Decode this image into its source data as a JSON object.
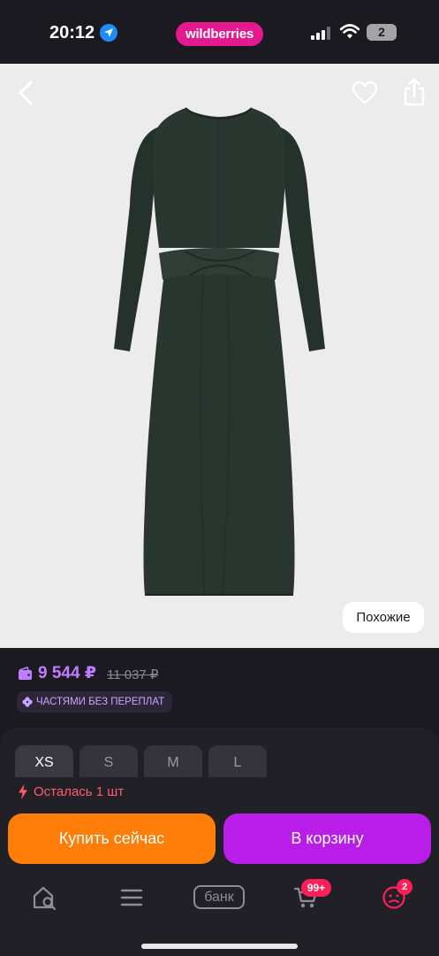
{
  "status_bar": {
    "time": "20:12",
    "brand": "wildberries",
    "battery_level": "2",
    "icons": [
      "location-arrow-icon",
      "signal-icon",
      "wifi-icon",
      "battery-icon"
    ]
  },
  "product": {
    "image": "dark-green-dress",
    "background_color": "#ececec",
    "dress_color": "#27342e",
    "actions": {
      "back_icon": "chevron-left-icon",
      "favorite_icon": "heart-icon",
      "share_icon": "share-icon"
    },
    "similar_label": "Похожие"
  },
  "price": {
    "current": "9 544 ₽",
    "old": "11 037 ₽",
    "installment_label": "ЧАСТЯМИ БЕЗ ПЕРЕПЛАТ",
    "accent_color": "#c27cff"
  },
  "sizes": {
    "options": [
      "XS",
      "S",
      "M",
      "L"
    ],
    "selected": "XS"
  },
  "stock": {
    "label": "Осталась 1 шт"
  },
  "actions": {
    "buy_now": "Купить сейчас",
    "add_to_cart": "В корзину",
    "buy_color": "#ff7d08",
    "cart_color": "#b91ee8"
  },
  "tab_bar": {
    "bank_label": "банк",
    "cart_badge": "99+",
    "profile_badge": "2",
    "icons": [
      "home-search-icon",
      "menu-icon",
      "bank-icon",
      "cart-icon",
      "profile-icon"
    ]
  }
}
